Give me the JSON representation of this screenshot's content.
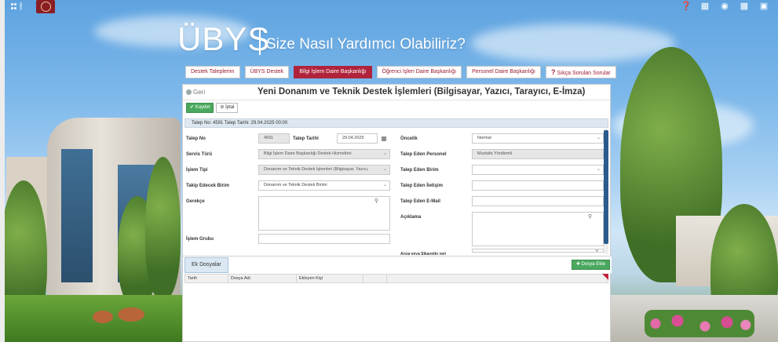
{
  "topbar": {
    "menu_label": "men",
    "icons": [
      "help-icon",
      "calendar-icon",
      "globe-icon",
      "apps-grid-icon",
      "lock-icon"
    ]
  },
  "hero": {
    "brand": "ÜBYS",
    "subtitle": "Size Nasıl Yardımcı Olabiliriz?"
  },
  "tabs": [
    {
      "label": "Destek Taleplerim",
      "active": false
    },
    {
      "label": "ÜBYS Destek",
      "active": false
    },
    {
      "label": "Bilgi İşlem Daire Başkanlığı",
      "active": true
    },
    {
      "label": "Öğrenci İşleri Daire Başkanlığı",
      "active": false
    },
    {
      "label": "Personel Daire Başkanlığı",
      "active": false
    },
    {
      "label": "Sıkça Sorulan Sorular",
      "active": false,
      "icon": "question-icon"
    }
  ],
  "panel": {
    "back_label": "Geri",
    "title": "Yeni Donanım ve Teknik Destek İşlemleri (Bilgisayar, Yazıcı, Tarayıcı, E-İmza)",
    "save_label": "Kaydet",
    "cancel_label": "İptal",
    "info": "Talep No: 4591   Talep Tarihi: 29.04.2025 00:00"
  },
  "form": {
    "talep_no": {
      "label": "Talep No",
      "value": "4591"
    },
    "talep_tarihi": {
      "label": "Talep Tarihi",
      "value": "29.04.2025"
    },
    "oncelik": {
      "label": "Öncelik",
      "value": "Normal"
    },
    "servis_turu": {
      "label": "Servis Türü",
      "value": "Bilgi İşlem Daire Başkanlığı Destek Hizmetleri"
    },
    "talep_eden_personel": {
      "label": "Talep Eden Personel",
      "value": "Mustafa Yöndemli"
    },
    "islem_tipi": {
      "label": "İşlem Tipi",
      "value": "Donanım ve Teknik Destek İşlemleri (Bilgisayar, Yazıcı,"
    },
    "talep_eden_birim": {
      "label": "Talep Eden Birim",
      "value": ""
    },
    "takip_birim": {
      "label": "Takip Edecek Birim",
      "value": "Donanım ve Teknik Destek Birimi"
    },
    "talep_eden_iletisim": {
      "label": "Talep Eden İletişim",
      "value": ""
    },
    "gerekce": {
      "label": "Gerekçe",
      "value": ""
    },
    "talep_eden_email": {
      "label": "Talep Eden E-Mail",
      "value": ""
    },
    "aciklama": {
      "label": "Açıklama",
      "value": ""
    },
    "islem_grubu": {
      "label": "İşlem Grubu",
      "value": ""
    },
    "cut_label": "Arıza veya Şikayetin yeri"
  },
  "files": {
    "tab_label": "Ek Dosyalar",
    "add_label": "Dosya Ekle",
    "columns": [
      "Tarih",
      "Dosya Adı",
      "Ekleyen Kişi",
      "",
      ""
    ]
  }
}
